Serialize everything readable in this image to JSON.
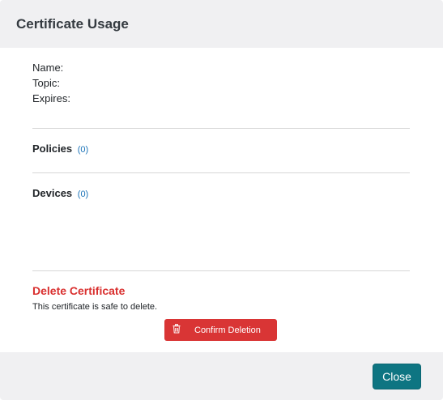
{
  "modal": {
    "title": "Certificate Usage",
    "info": {
      "name_label": "Name:",
      "topic_label": "Topic:",
      "expires_label": "Expires:"
    },
    "policies": {
      "label": "Policies",
      "count": "(0)"
    },
    "devices": {
      "label": "Devices",
      "count": "(0)"
    },
    "delete_section": {
      "title": "Delete Certificate",
      "description": "This certificate is safe to delete.",
      "confirm_label": "Confirm Deletion",
      "confirm_icon": "trash-icon"
    },
    "footer": {
      "close_label": "Close"
    }
  },
  "colors": {
    "header_bg": "#f0f0f2",
    "danger": "#d93535",
    "primary": "#0e7582",
    "count_link": "#1a73b8"
  }
}
